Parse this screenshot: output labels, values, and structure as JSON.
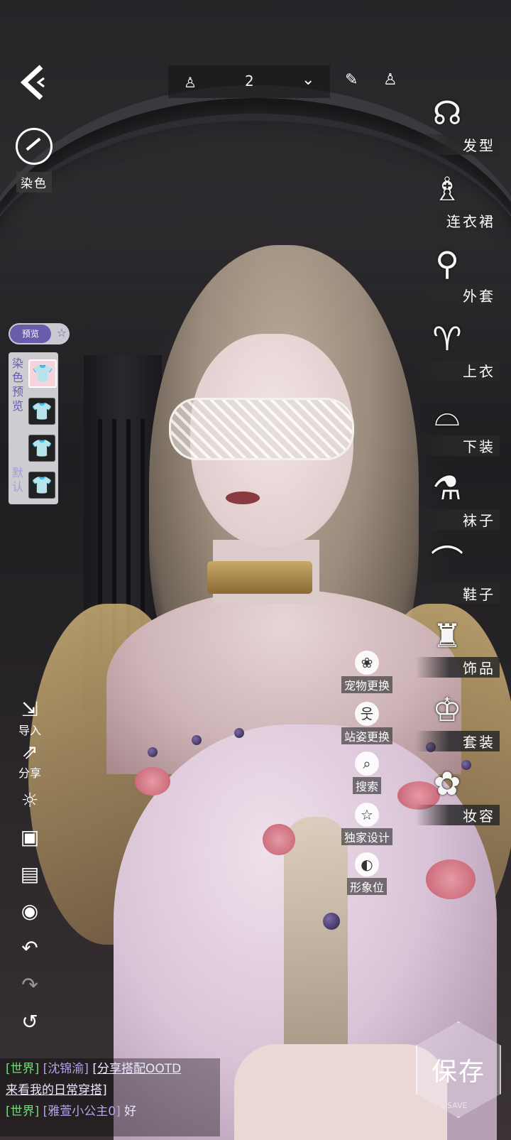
{
  "topbar": {
    "outfit_number": "2"
  },
  "dye": {
    "label": "染色"
  },
  "preview_toggle": {
    "label": "预览"
  },
  "dye_panel": {
    "title": "染色预览",
    "default_label": "默认"
  },
  "categories": [
    {
      "label": "发型",
      "icon": "hair-icon"
    },
    {
      "label": "连衣裙",
      "icon": "dress-icon"
    },
    {
      "label": "外套",
      "icon": "coat-icon"
    },
    {
      "label": "上衣",
      "icon": "top-icon"
    },
    {
      "label": "下装",
      "icon": "skirt-icon"
    },
    {
      "label": "袜子",
      "icon": "socks-icon"
    },
    {
      "label": "鞋子",
      "icon": "shoe-icon"
    },
    {
      "label": "饰品",
      "icon": "bag-icon"
    },
    {
      "label": "套装",
      "icon": "suit-icon"
    },
    {
      "label": "妆容",
      "icon": "makeup-icon"
    }
  ],
  "mid_actions": [
    {
      "label": "宠物更换",
      "icon": "paw-icon"
    },
    {
      "label": "站姿更换",
      "icon": "pose-icon"
    },
    {
      "label": "搜索",
      "icon": "search-icon"
    },
    {
      "label": "独家设计",
      "icon": "star-icon"
    },
    {
      "label": "形象位",
      "icon": "avatar-slot-icon"
    }
  ],
  "left_tools": {
    "import_label": "导入",
    "share_label": "分享"
  },
  "chat": {
    "line1_channel": "[世界]",
    "line1_name": "[沈锦渝]",
    "line1_text": "[分享搭配OOTD",
    "line1_cont": "来看我的日常穿搭]",
    "line2_channel": "[世界]",
    "line2_name": "[雅萱小公主0]",
    "line2_text": "好"
  },
  "save": {
    "label": "保存",
    "sub": "SAVE"
  },
  "colors": {
    "accent": "#6b5cab",
    "chat_channel": "#6fdc79",
    "chat_name": "#b3a4e8"
  }
}
